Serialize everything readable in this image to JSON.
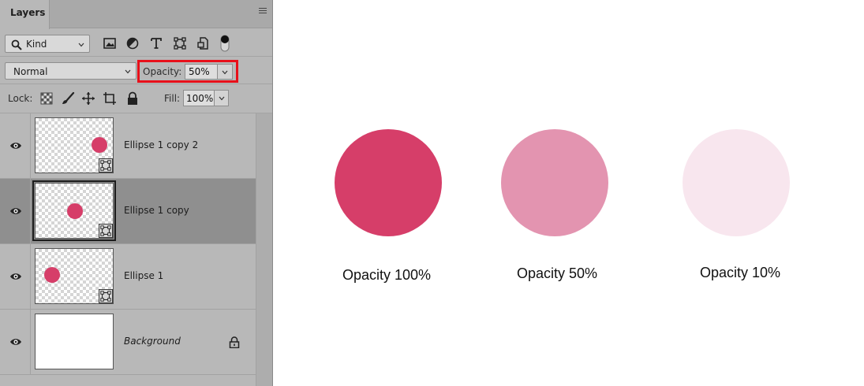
{
  "panel": {
    "tab_label": "Layers",
    "filter": {
      "kind_label": "Kind"
    },
    "blend_mode": "Normal",
    "opacity": {
      "label": "Opacity:",
      "value": "50%"
    },
    "lock_label": "Lock:",
    "fill": {
      "label": "Fill:",
      "value": "100%"
    },
    "layers": [
      {
        "name": "Ellipse 1 copy 2",
        "selected": false,
        "type": "shape"
      },
      {
        "name": "Ellipse 1 copy",
        "selected": true,
        "type": "shape"
      },
      {
        "name": "Ellipse 1",
        "selected": false,
        "type": "shape"
      },
      {
        "name": "Background",
        "selected": false,
        "type": "background",
        "locked": true
      }
    ]
  },
  "demo": {
    "accent_color": "#d63e69",
    "circles": [
      {
        "caption": "Opacity 100%",
        "color": "#d63e69"
      },
      {
        "caption": "Opacity 50%",
        "color": "#e394b0"
      },
      {
        "caption": "Opacity 10%",
        "color": "#f8e6ee"
      }
    ]
  }
}
